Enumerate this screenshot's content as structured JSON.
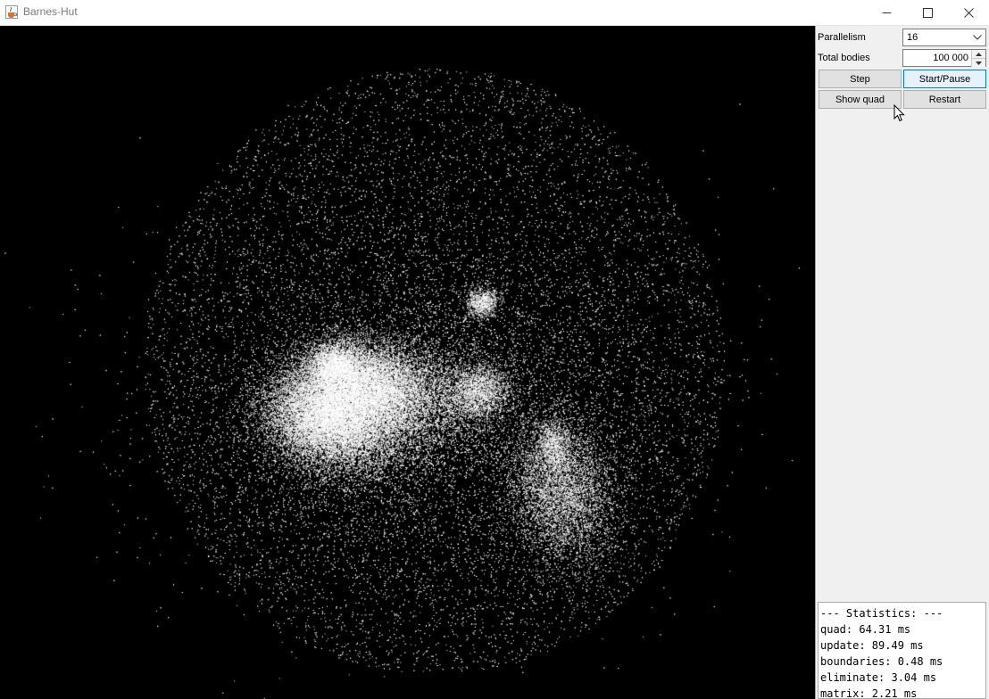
{
  "window": {
    "title": "Barnes-Hut",
    "icon": "java-cup-icon",
    "controls": [
      "minimize-icon",
      "maximize-icon",
      "close-icon"
    ]
  },
  "panel": {
    "parallelism_label": "Parallelism",
    "parallelism_value": "16",
    "total_bodies_label": "Total bodies",
    "total_bodies_value": "100 000",
    "step_label": "Step",
    "start_pause_label": "Start/Pause",
    "show_quad_label": "Show quad",
    "restart_label": "Restart"
  },
  "statistics": {
    "header": "--- Statistics: ---",
    "lines": [
      "quad: 64.31 ms",
      "update: 89.49 ms",
      "boundaries: 0.48 ms",
      "eliminate: 3.04 ms",
      "matrix: 2.21 ms"
    ]
  },
  "colors": {
    "canvas_bg": "#000000",
    "particle": "#ffffff",
    "focused_button_border": "#0078d7"
  }
}
